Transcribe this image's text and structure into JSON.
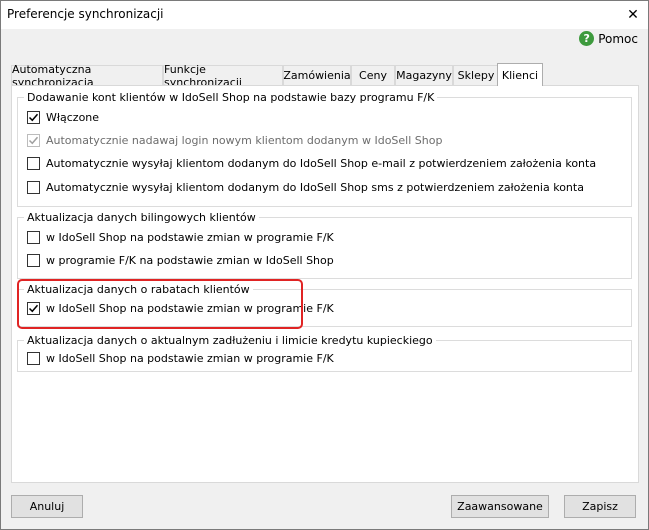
{
  "window": {
    "title": "Preferencje synchronizacji",
    "close_glyph": "✕"
  },
  "help": {
    "label": "Pomoc",
    "icon": "?"
  },
  "tabs": [
    {
      "label": "Automatyczna synchronizacja"
    },
    {
      "label": "Funkcje synchronizacji"
    },
    {
      "label": "Zamówienia"
    },
    {
      "label": "Ceny"
    },
    {
      "label": "Magazyny"
    },
    {
      "label": "Sklepy"
    },
    {
      "label": "Klienci",
      "active": true
    }
  ],
  "groups": {
    "accounts": {
      "legend": "Dodawanie kont klientów w IdoSell Shop na podstawie bazy programu F/K",
      "items": [
        {
          "label": "Włączone",
          "checked": true,
          "disabled": false
        },
        {
          "label": "Automatycznie nadawaj login nowym klientom dodanym w IdoSell Shop",
          "checked": true,
          "disabled": true
        },
        {
          "label": "Automatycznie wysyłaj klientom dodanym do IdoSell Shop e-mail z potwierdzeniem założenia konta",
          "checked": false,
          "disabled": false
        },
        {
          "label": "Automatycznie wysyłaj klientom dodanym do IdoSell Shop sms z potwierdzeniem założenia konta",
          "checked": false,
          "disabled": false
        }
      ]
    },
    "billing": {
      "legend": "Aktualizacja danych bilingowych klientów",
      "items": [
        {
          "label": "w IdoSell Shop na podstawie zmian w programie F/K",
          "checked": false
        },
        {
          "label": "w programie F/K na podstawie zmian w IdoSell Shop",
          "checked": false
        }
      ]
    },
    "discounts": {
      "legend": "Aktualizacja danych o rabatach klientów",
      "items": [
        {
          "label": "w IdoSell Shop na podstawie zmian w programie F/K",
          "checked": true
        }
      ]
    },
    "debt": {
      "legend": "Aktualizacja danych o aktualnym zadłużeniu i limicie kredytu kupieckiego",
      "items": [
        {
          "label": "w IdoSell Shop na podstawie zmian w programie F/K",
          "checked": false
        }
      ]
    }
  },
  "buttons": {
    "cancel": "Anuluj",
    "advanced": "Zaawansowane",
    "save": "Zapisz"
  },
  "colors": {
    "highlight": "#e02424",
    "help_icon": "#3d9a3d"
  }
}
